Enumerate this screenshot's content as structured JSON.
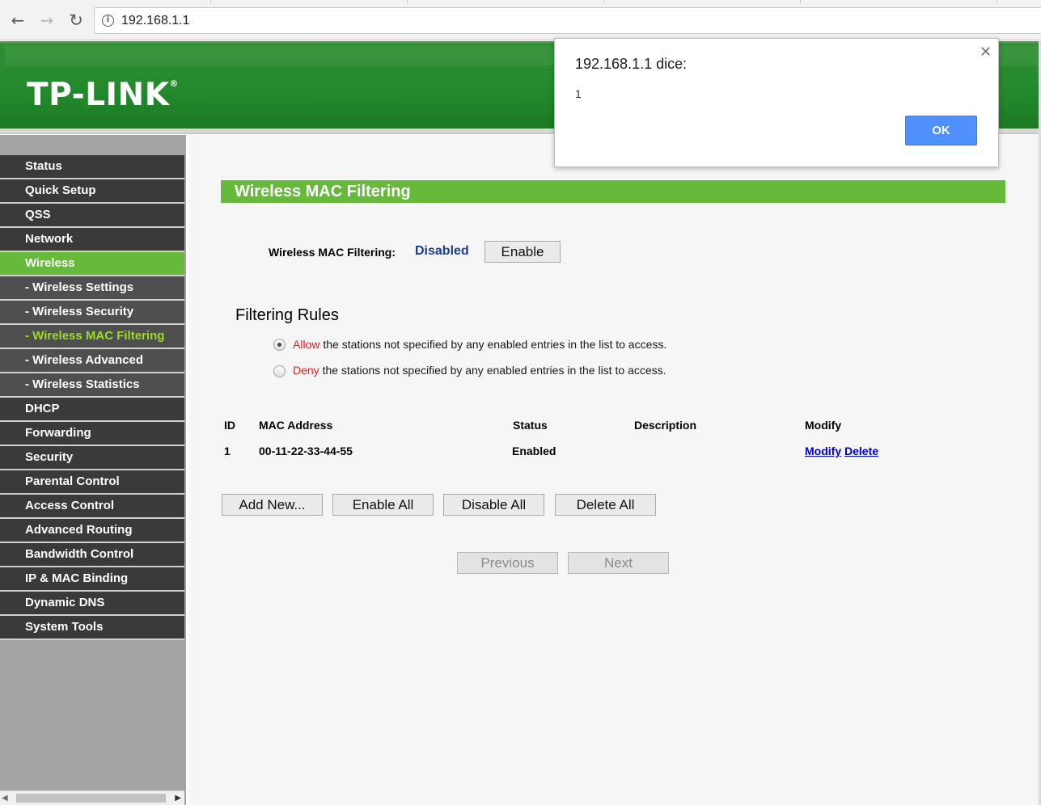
{
  "browser": {
    "url": "192.168.1.1",
    "icons": {
      "back": "back-arrow-icon",
      "forward": "forward-arrow-icon",
      "reload": "reload-icon",
      "info": "info-icon"
    }
  },
  "router": {
    "logo": "TP-LINK",
    "brand_colors": {
      "header_green": "#238a2c",
      "accent_green": "#66b93a",
      "menu_dark": "#3a3a3a",
      "highlight_text": "#9bdc2c"
    }
  },
  "sidebar": {
    "items": [
      {
        "label": "Status",
        "type": "main"
      },
      {
        "label": "Quick Setup",
        "type": "main"
      },
      {
        "label": "QSS",
        "type": "main"
      },
      {
        "label": "Network",
        "type": "main"
      },
      {
        "label": "Wireless",
        "type": "main",
        "active": true
      },
      {
        "label": "- Wireless Settings",
        "type": "sub"
      },
      {
        "label": "- Wireless Security",
        "type": "sub"
      },
      {
        "label": "- Wireless MAC Filtering",
        "type": "sub",
        "current": true
      },
      {
        "label": "- Wireless Advanced",
        "type": "sub"
      },
      {
        "label": "- Wireless Statistics",
        "type": "sub"
      },
      {
        "label": "DHCP",
        "type": "main"
      },
      {
        "label": "Forwarding",
        "type": "main"
      },
      {
        "label": "Security",
        "type": "main"
      },
      {
        "label": "Parental Control",
        "type": "main"
      },
      {
        "label": "Access Control",
        "type": "main"
      },
      {
        "label": "Advanced Routing",
        "type": "main"
      },
      {
        "label": "Bandwidth Control",
        "type": "main"
      },
      {
        "label": "IP & MAC Binding",
        "type": "main"
      },
      {
        "label": "Dynamic DNS",
        "type": "main"
      },
      {
        "label": "System Tools",
        "type": "main"
      }
    ]
  },
  "main": {
    "title": "Wireless MAC Filtering",
    "filtering_label": "Wireless MAC Filtering:",
    "filtering_status": "Disabled",
    "enable_button": "Enable",
    "rules_title": "Filtering Rules",
    "rules": [
      {
        "keyword": "Allow",
        "text": " the stations not specified by any enabled entries in the list to access.",
        "selected": true
      },
      {
        "keyword": "Deny",
        "text": " the stations not specified by any enabled entries in the list to access.",
        "selected": false
      }
    ],
    "table": {
      "headers": {
        "id": "ID",
        "mac": "MAC Address",
        "status": "Status",
        "description": "Description",
        "modify": "Modify"
      },
      "rows": [
        {
          "id": "1",
          "mac": "00-11-22-33-44-55",
          "status": "Enabled",
          "description": "",
          "modify_link": "Modify",
          "delete_link": "Delete"
        }
      ]
    },
    "buttons": {
      "add_new": "Add New...",
      "enable_all": "Enable All",
      "disable_all": "Disable All",
      "delete_all": "Delete All",
      "previous": "Previous",
      "next": "Next"
    }
  },
  "alert": {
    "title": "192.168.1.1 dice:",
    "message": "1",
    "ok": "OK",
    "close_icon": "close-icon"
  }
}
